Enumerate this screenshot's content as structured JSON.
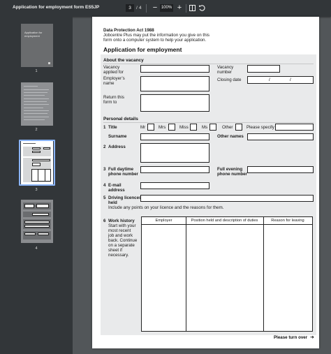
{
  "toolbar": {
    "title": "Application for employment form ES5JP",
    "current_page": "3",
    "page_separator": "/",
    "total_pages": "4",
    "zoom_out_label": "−",
    "zoom_level": "100%",
    "zoom_in_label": "+"
  },
  "sidebar": {
    "thumbnails": [
      {
        "number": "1",
        "text": "Application for employment"
      },
      {
        "number": "2"
      },
      {
        "number": "3",
        "selected": true
      },
      {
        "number": "4"
      }
    ]
  },
  "page": {
    "dp_title": "Data Protection Act 1988",
    "dp_line1": "Jobcentre Plus may put the information you give on this",
    "dp_line2": "form onto a computer system to help your application.",
    "heading": "Application for employment",
    "about": {
      "heading": "About the vacancy",
      "vacancy_applied_line1": "Vacancy",
      "vacancy_applied_line2": "applied for",
      "vacancy_number_line1": "Vacancy",
      "vacancy_number_line2": "number",
      "employer_name_line1": "Employer’s",
      "employer_name_line2": "name",
      "closing_date": "Closing date",
      "date_sep1": "/",
      "date_sep2": "/",
      "return_line1": "Return this",
      "return_line2": "form to"
    },
    "personal": {
      "heading": "Personal details",
      "title_num": "1",
      "title_label": "Title",
      "mr": "Mr",
      "mrs": "Mrs",
      "miss": "Miss",
      "ms": "Ms",
      "other": "Other",
      "please_specify": "Please specify",
      "surname": "Surname",
      "other_names": "Other names",
      "address_num": "2",
      "address_label": "Address",
      "phone_num": "3",
      "phone_line1": "Full daytime",
      "phone_line2": "phone number",
      "evening_line1": "Full evening",
      "evening_line2": "phone number",
      "email_num": "4",
      "email_line1": "E-mail",
      "email_line2": "address",
      "licence_num": "5",
      "licence_line1": "Driving licences",
      "licence_line2": "held",
      "licence_note": "Include any points on your licence and the reasons for them.",
      "work_num": "6",
      "work_title": "Work history",
      "work_desc": [
        "Start with your",
        "most recent",
        "job and work",
        "back. Continue",
        "on a separate",
        "sheet if",
        "necessary."
      ],
      "work_table_headers": [
        "Employer",
        "Position held and description of duties",
        "Reason for leaving"
      ]
    },
    "turn_over": "Please turn over",
    "turn_arrow": "➜"
  }
}
